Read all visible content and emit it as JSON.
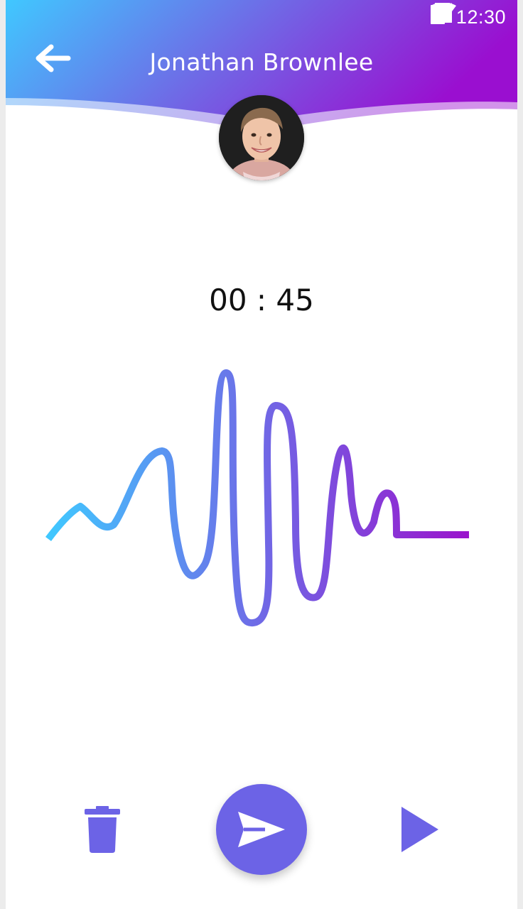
{
  "status_bar": {
    "time": "12:30",
    "icons": [
      "wifi-icon",
      "signal-icon",
      "battery-icon"
    ]
  },
  "header": {
    "back_icon": "arrow-left-icon",
    "contact_name": "Jonathan Brownlee",
    "gradient_start": "#40c8ff",
    "gradient_end": "#9a0fd0"
  },
  "recording": {
    "timer": "00 : 45",
    "wave_color_start": "#40c8ff",
    "wave_color_end": "#9a14cc"
  },
  "controls": {
    "delete_icon": "trash-icon",
    "send_icon": "send-icon",
    "play_icon": "play-icon",
    "accent": "#6c63e6"
  }
}
